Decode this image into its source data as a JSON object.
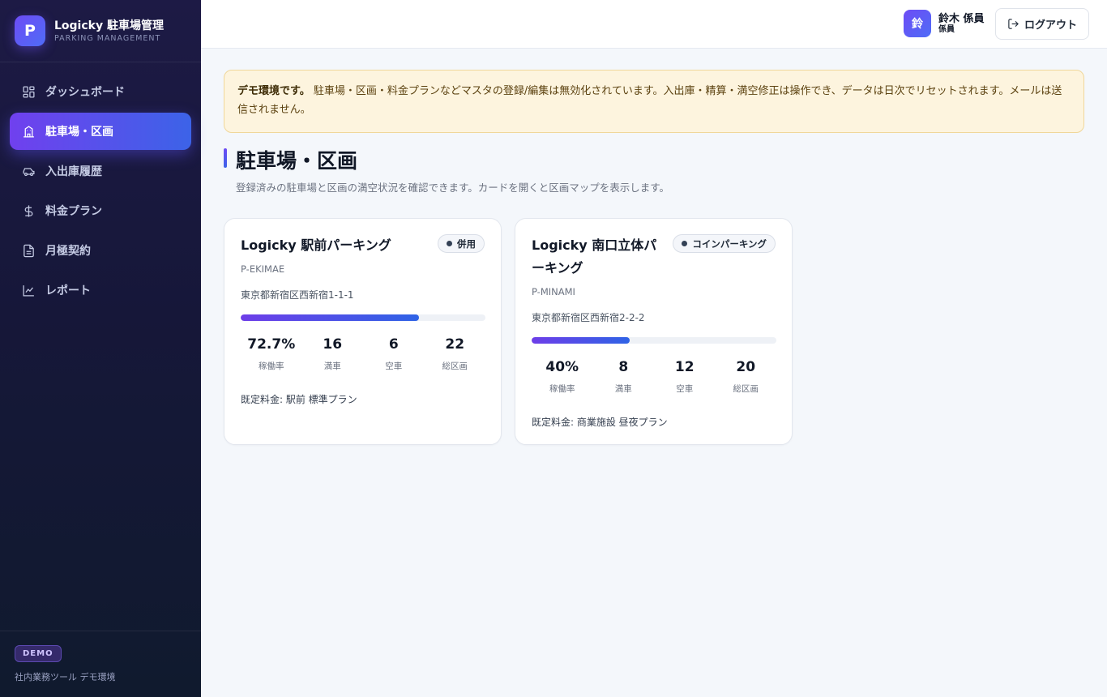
{
  "brand": {
    "logo": "P",
    "title": "Logicky 駐車場管理",
    "subtitle": "PARKING MANAGEMENT"
  },
  "nav": [
    {
      "label": "ダッシュボード",
      "icon": "dashboard-icon",
      "active": false
    },
    {
      "label": "駐車場・区画",
      "icon": "building-icon",
      "active": true
    },
    {
      "label": "入出庫履歴",
      "icon": "car-icon",
      "active": false
    },
    {
      "label": "料金プラン",
      "icon": "dollar-icon",
      "active": false
    },
    {
      "label": "月極契約",
      "icon": "document-icon",
      "active": false
    },
    {
      "label": "レポート",
      "icon": "chart-icon",
      "active": false
    }
  ],
  "footer": {
    "badge": "DEMO",
    "text": "社内業務ツール デモ環境"
  },
  "header": {
    "user_avatar": "鈴",
    "user_name": "鈴木 係員",
    "user_role": "係員",
    "logout_label": "ログアウト"
  },
  "notice": {
    "strong": "デモ環境です。",
    "text": "駐車場・区画・料金プランなどマスタの登録/編集は無効化されています。入出庫・精算・満空修正は操作でき、データは日次でリセットされます。メールは送信されません。"
  },
  "page": {
    "title": "駐車場・区画",
    "description": "登録済みの駐車場と区画の満空状況を確認できます。カードを開くと区画マップを表示します。"
  },
  "lots": [
    {
      "name": "Logicky 駅前パーキング",
      "tag": "併用",
      "code": "P-EKIMAE",
      "address": "東京都新宿区西新宿1-1-1",
      "occupancy": 0.727,
      "stats": [
        {
          "value": "72.7%",
          "label": "稼働率"
        },
        {
          "value": "16",
          "label": "満車"
        },
        {
          "value": "6",
          "label": "空車"
        },
        {
          "value": "22",
          "label": "総区画"
        }
      ],
      "plan": "既定料金: 駅前 標準プラン"
    },
    {
      "name": "Logicky 南口立体パーキング",
      "tag": "コインパーキング",
      "code": "P-MINAMI",
      "address": "東京都新宿区西新宿2-2-2",
      "occupancy": 0.4,
      "stats": [
        {
          "value": "40%",
          "label": "稼働率"
        },
        {
          "value": "8",
          "label": "満車"
        },
        {
          "value": "12",
          "label": "空車"
        },
        {
          "value": "20",
          "label": "総区画"
        }
      ],
      "plan": "既定料金: 商業施設 昼夜プラン"
    }
  ]
}
